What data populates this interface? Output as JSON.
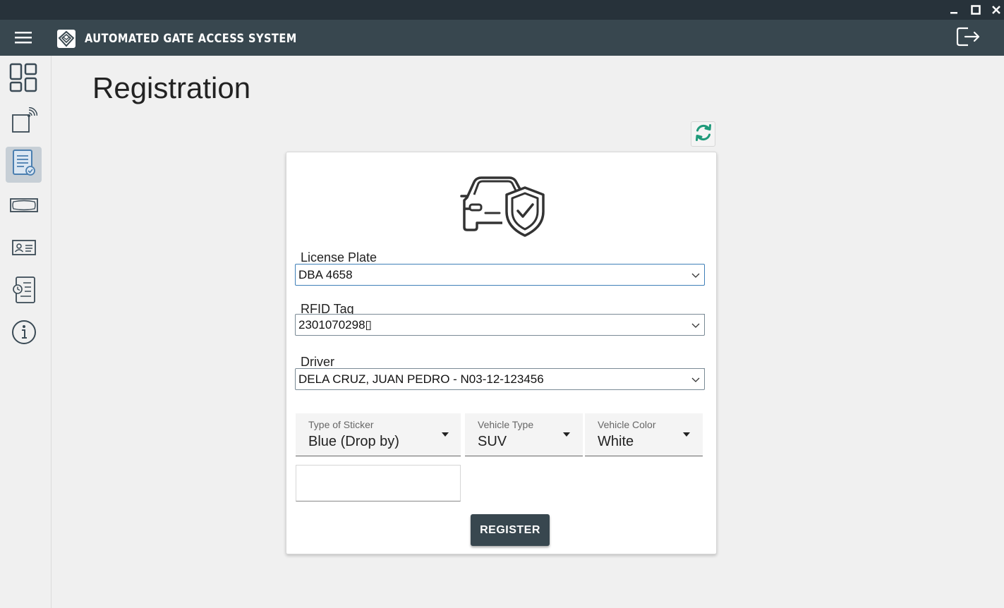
{
  "app": {
    "title": "AUTOMATED GATE ACCESS SYSTEM"
  },
  "window_controls": {
    "minimize_icon": "minimize-icon",
    "maximize_icon": "maximize-icon",
    "close_icon": "close-icon"
  },
  "sidebar": {
    "items": [
      {
        "icon": "dashboard-icon",
        "active": false
      },
      {
        "icon": "rfid-reader-icon",
        "active": false
      },
      {
        "icon": "registration-document-icon",
        "active": true
      },
      {
        "icon": "sticker-card-icon",
        "active": false
      },
      {
        "icon": "id-card-icon",
        "active": false
      },
      {
        "icon": "logs-clock-icon",
        "active": false
      },
      {
        "icon": "info-icon",
        "active": false
      }
    ]
  },
  "page": {
    "title": "Registration"
  },
  "form": {
    "license_plate": {
      "label": "License Plate",
      "value": "DBA 4658"
    },
    "rfid_tag": {
      "label": "RFID Tag",
      "value": "2301070298▯"
    },
    "driver": {
      "label": "Driver",
      "value": "DELA CRUZ, JUAN PEDRO - N03-12-123456"
    },
    "sticker_type": {
      "label": "Type of Sticker",
      "value": "Blue (Drop by)"
    },
    "vehicle_type": {
      "label": "Vehicle Type",
      "value": "SUV"
    },
    "vehicle_color": {
      "label": "Vehicle Color",
      "value": "White"
    },
    "extra_input": {
      "value": ""
    },
    "register_label": "REGISTER"
  },
  "colors": {
    "titlebar": "#27323a",
    "appbar": "#38474f",
    "accent_green": "#1f9a7a",
    "focus_blue": "#3f7fb8",
    "active_nav": "#c7cfd6"
  }
}
